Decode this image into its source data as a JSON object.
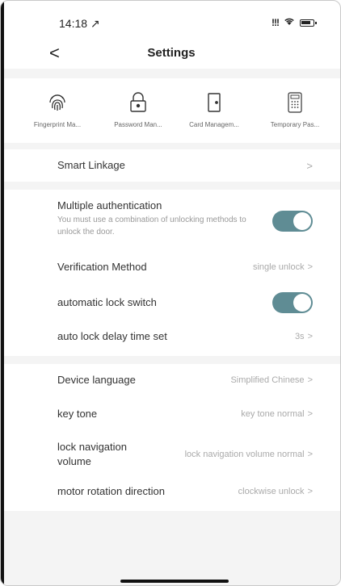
{
  "status_bar": {
    "time": "14:18 ↗",
    "signal": "!!!",
    "wifi": "ᯤ"
  },
  "header": {
    "back_label": "<",
    "title": "Settings"
  },
  "features": [
    {
      "label": "Fingerprint Ma...",
      "icon": "fingerprint-icon"
    },
    {
      "label": "Password Man...",
      "icon": "padlock-icon"
    },
    {
      "label": "Card Managem...",
      "icon": "card-door-icon"
    },
    {
      "label": "Temporary Pas...",
      "icon": "keypad-icon"
    }
  ],
  "smart_linkage": {
    "label": "Smart Linkage",
    "chevron": ">"
  },
  "multiple_auth": {
    "label": "Multiple authentication",
    "description": "You must use a combination of unlocking methods to unlock the door.",
    "enabled": true
  },
  "verification": {
    "label": "Verification Method",
    "value": "single unlock",
    "chevron": ">"
  },
  "auto_lock": {
    "label": "automatic lock switch",
    "enabled": true
  },
  "auto_lock_delay": {
    "label": "auto lock delay time set",
    "value": "3s",
    "chevron": ">"
  },
  "device_language": {
    "label": "Device language",
    "value": "Simplified Chinese",
    "chevron": ">"
  },
  "key_tone": {
    "label": "key tone",
    "value": "key tone normal",
    "chevron": ">"
  },
  "lock_nav_volume": {
    "label_line1": "lock navigation",
    "label_line2": "volume",
    "value": "lock navigation volume normal",
    "chevron": ">"
  },
  "motor_direction": {
    "label": "motor rotation direction",
    "value": "clockwise unlock",
    "chevron": ">"
  },
  "colors": {
    "toggle_on": "#5f8c94",
    "section_gap": "#f4f4f4"
  }
}
